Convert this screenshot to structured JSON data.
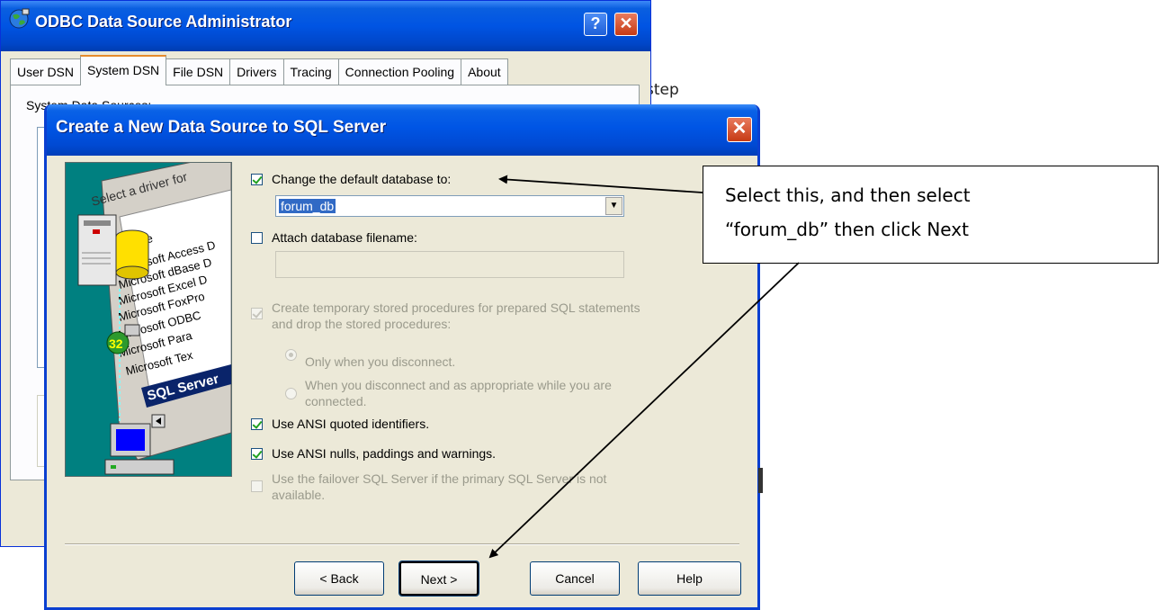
{
  "background": {
    "text": "step"
  },
  "back_window": {
    "title": "ODBC Data Source Administrator",
    "title_buttons": {
      "help": "?",
      "close": "✕"
    },
    "tabs": [
      {
        "label": "User DSN",
        "active": false
      },
      {
        "label": "System DSN",
        "active": true
      },
      {
        "label": "File DSN",
        "active": false
      },
      {
        "label": "Drivers",
        "active": false
      },
      {
        "label": "Tracing",
        "active": false
      },
      {
        "label": "Connection Pooling",
        "active": false
      },
      {
        "label": "About",
        "active": false
      }
    ],
    "panel_label": "System Data Sources:"
  },
  "dialog": {
    "title": "Create a New Data Source to SQL Server",
    "close_label": "✕",
    "wizard_art": {
      "header": "Select a driver for",
      "column": "Name",
      "items": [
        "Microsoft Access D",
        "Microsoft dBase D",
        "Microsoft Excel D",
        "Microsoft FoxPro",
        "Microsoft ODBC",
        "Microsoft Para",
        "Microsoft Tex",
        "SQL Server"
      ],
      "badge": "32"
    },
    "options": {
      "change_default_db": {
        "label": "Change the default database to:",
        "checked": true,
        "enabled": true
      },
      "default_db_value": "forum_db",
      "attach_db": {
        "label": "Attach database filename:",
        "checked": false,
        "enabled": true
      },
      "attach_db_value": "",
      "create_temp_procs": {
        "label_line1": "Create temporary stored procedures for prepared SQL statements",
        "label_line2": "and drop the stored procedures:",
        "checked": true,
        "enabled": false
      },
      "radio_disconnect": {
        "label": "Only when you disconnect.",
        "selected": true
      },
      "radio_appropriate": {
        "label_line1": "When you disconnect and as appropriate while you are",
        "label_line2": "connected.",
        "selected": false
      },
      "ansi_quoted": {
        "label": "Use ANSI quoted identifiers.",
        "checked": true,
        "enabled": true
      },
      "ansi_nulls": {
        "label": "Use ANSI nulls, paddings and warnings.",
        "checked": true,
        "enabled": true
      },
      "failover": {
        "label_line1": "Use the failover SQL Server if the primary SQL Server is not",
        "label_line2": "available.",
        "checked": false,
        "enabled": false
      }
    },
    "buttons": {
      "back": "< Back",
      "next": "Next >",
      "cancel": "Cancel",
      "help": "Help"
    }
  },
  "callout": {
    "line1": "Select this, and then select",
    "line2": "“forum_db” then click Next"
  },
  "colors": {
    "xp_blue": "#0054e3",
    "dialog_face": "#ece9d8",
    "selection": "#316ac5"
  }
}
